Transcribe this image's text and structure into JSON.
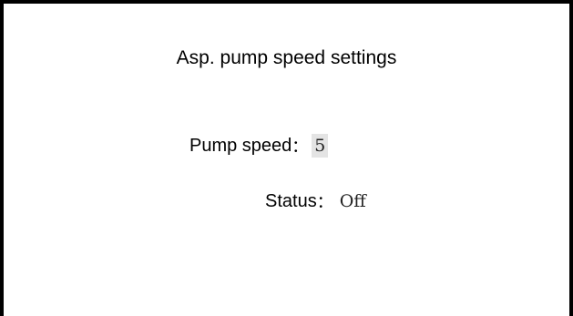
{
  "screen": {
    "title": "Asp. pump speed settings"
  },
  "pump_speed": {
    "label": "Pump speed",
    "separator": "：",
    "value": "5"
  },
  "status": {
    "label": "Status",
    "separator": "：",
    "value": "Off"
  },
  "colors": {
    "border": "#000000",
    "background": "#ffffff",
    "value_highlight": "#e4e4e4"
  }
}
